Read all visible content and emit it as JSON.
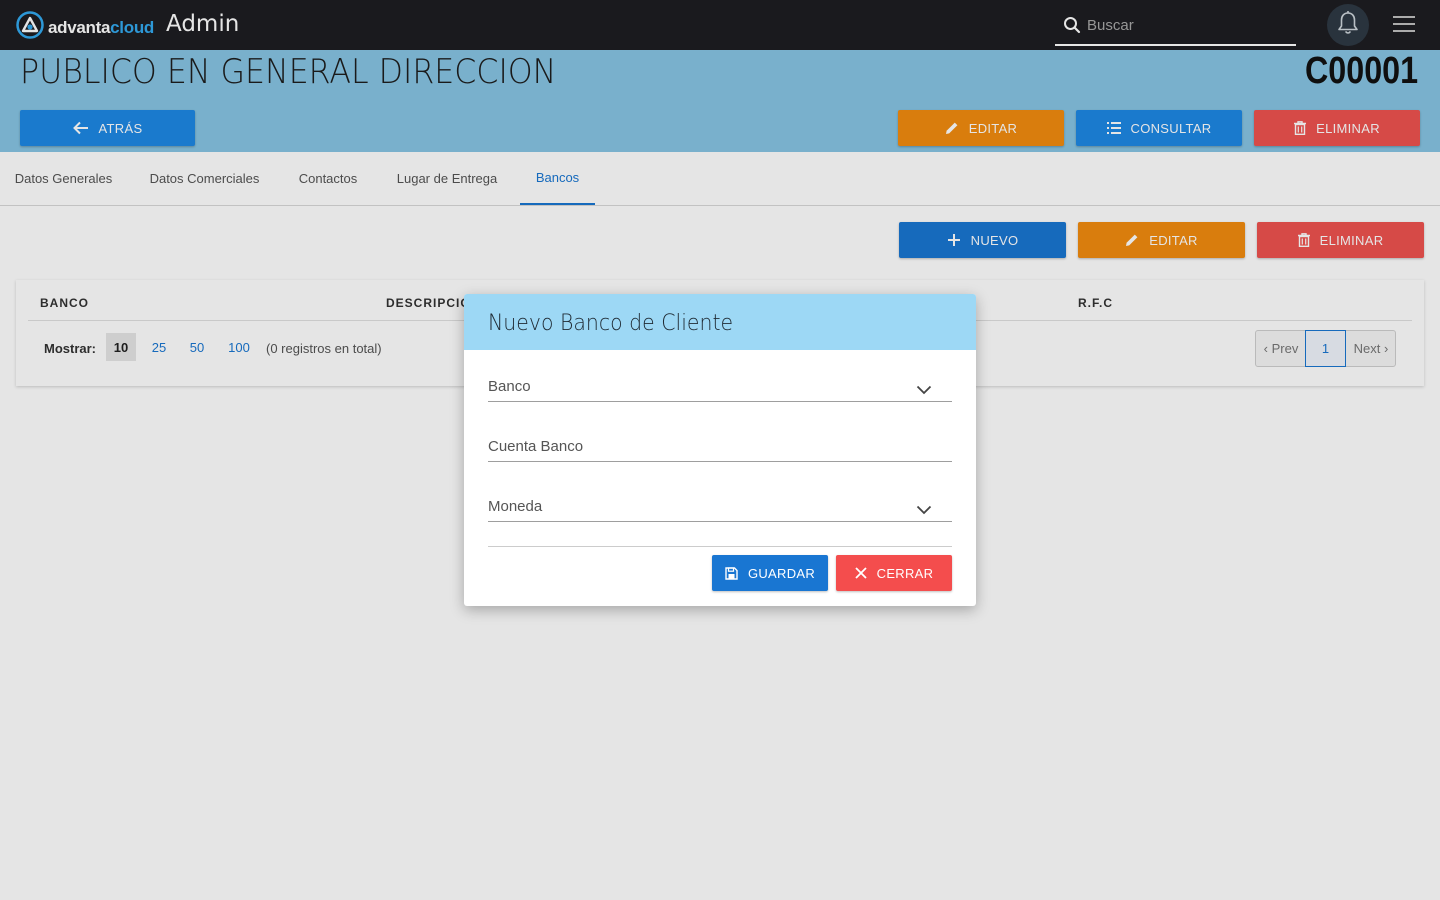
{
  "app": {
    "logo_part1": "advanta",
    "logo_part2": "cloud",
    "title": "Admin",
    "search_placeholder": "Buscar"
  },
  "header": {
    "title": "PUBLICO EN GENERAL DIRECCION",
    "code": "C00001",
    "back_label": "ATRÁS",
    "edit_label": "EDITAR",
    "consult_label": "CONSULTAR",
    "delete_label": "ELIMINAR"
  },
  "tabs": [
    {
      "label": "Datos Generales"
    },
    {
      "label": "Datos Comerciales"
    },
    {
      "label": "Contactos"
    },
    {
      "label": "Lugar de Entrega"
    },
    {
      "label": "Bancos",
      "active": true
    }
  ],
  "toolbar": {
    "new_label": "NUEVO",
    "edit_label": "EDITAR",
    "delete_label": "ELIMINAR"
  },
  "table": {
    "columns": [
      "BANCO",
      "DESCRIPCIÓN",
      "R.F.C"
    ],
    "show_label": "Mostrar:",
    "page_sizes": [
      "10",
      "25",
      "50",
      "100"
    ],
    "selected_page_size": "10",
    "total_text": "(0 registros en total)",
    "prev_label": "‹ Prev",
    "current_page": "1",
    "next_label": "Next ›"
  },
  "modal": {
    "title": "Nuevo Banco de Cliente",
    "fields": [
      {
        "label": "Banco",
        "type": "select"
      },
      {
        "label": "Cuenta Banco",
        "type": "text"
      },
      {
        "label": "Moneda",
        "type": "select"
      }
    ],
    "save_label": "GUARDAR",
    "close_label": "CERRAR"
  },
  "colors": {
    "navbar": "#1e1e22",
    "header_bg": "#87c5e4",
    "modal_header": "#9dd8f5",
    "primary": "#1e88e5",
    "warning": "#f28c0f",
    "danger": "#ef5350"
  }
}
